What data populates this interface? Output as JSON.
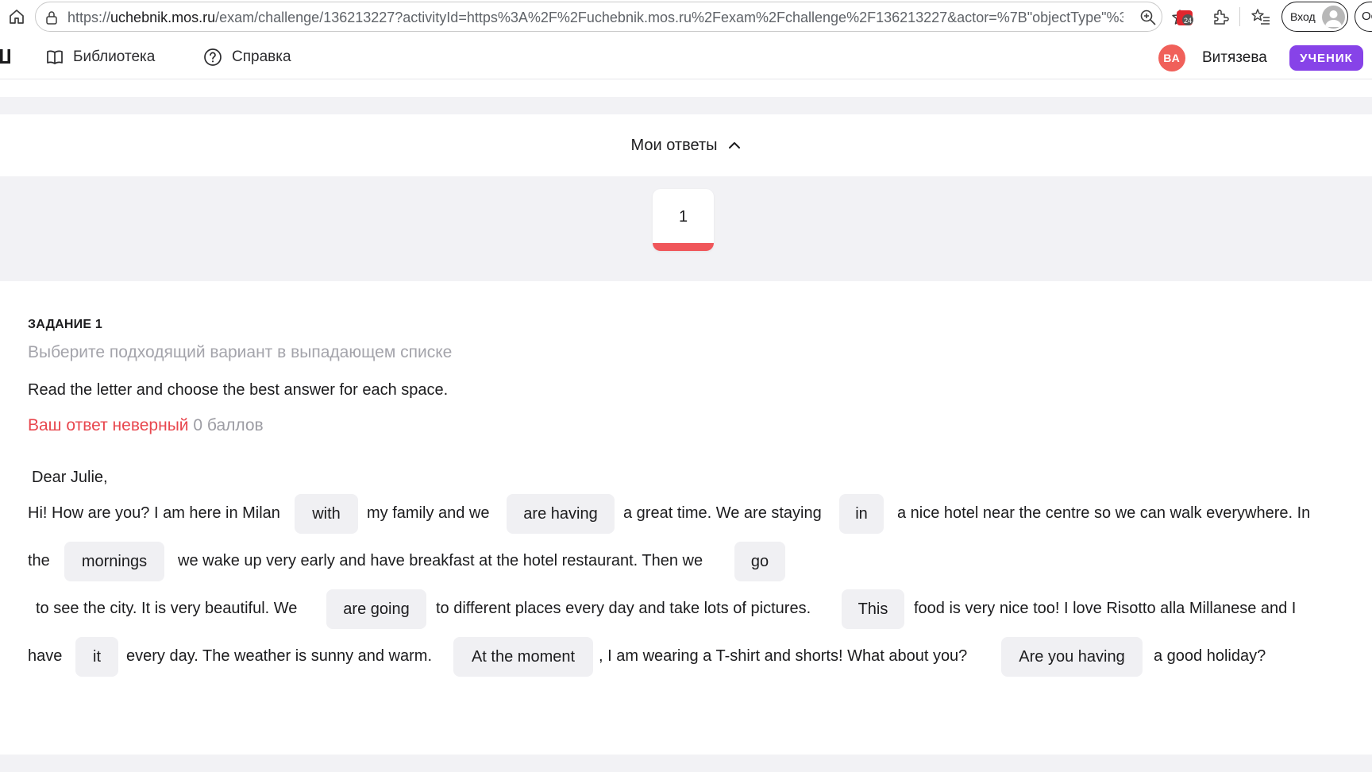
{
  "browser": {
    "url_prefix": "https://",
    "url_host": "uchebnik.mos.ru",
    "url_path": "/exam/challenge/136213227?activityId=https%3A%2F%2Fuchebnik.mos.ru%2Fexam%2Fchallenge%2F136213227&actor=%7B\"objectType\"%3A...",
    "extension_badge": "24",
    "login_label": "Вход",
    "corner_label": "Ос"
  },
  "header": {
    "nav": [
      {
        "label": "Библиотека",
        "icon": "book-icon"
      },
      {
        "label": "Справка",
        "icon": "help-circle-icon"
      }
    ],
    "user_initials": "ВА",
    "user_name": "Витязева",
    "role": "УЧЕНИК",
    "colors": {
      "avatar": "#f0605a",
      "role_badge": "#8743e8"
    }
  },
  "answers": {
    "toggle_label": "Мои ответы",
    "toggle_icon": "chevron-up-icon",
    "questions": [
      {
        "number": "1",
        "status": "incorrect",
        "status_color": "#f0565a"
      }
    ]
  },
  "task": {
    "title": "ЗАДАНИЕ 1",
    "hint": "Выберите подходящий вариант в выпадающем списке",
    "instruction": "Read the letter and choose the best answer for each space.",
    "result_text": "Ваш ответ неверный",
    "result_points": "0 баллов",
    "salutation": "Dear Julie,",
    "text": {
      "s1": "Hi! How are you? I am here in Milan",
      "a1": "with",
      "s2": "my family and we",
      "a2": "are having",
      "s3": "a great time. We are staying",
      "a3": "in",
      "s4": "a nice hotel near the centre so we can walk everywhere. In",
      "s5": "the",
      "a4": "mornings",
      "s6": "we wake up very early and have breakfast at the hotel restaurant. Then we",
      "a5": "go",
      "s7": "to see the city. It is very beautiful. We",
      "a6": "are going",
      "s8": "to different places every day and take lots of pictures.",
      "a7": "This",
      "s9": "food is very nice too! I love Risotto alla Millanese and I",
      "s10": "have",
      "a8": "it",
      "s11": "every day. The weather is sunny and warm.",
      "a9": "At the moment",
      "s12": ", I am wearing a T-shirt and shorts! What about you?",
      "a10": "Are you having",
      "s13": "a good holiday?"
    }
  }
}
